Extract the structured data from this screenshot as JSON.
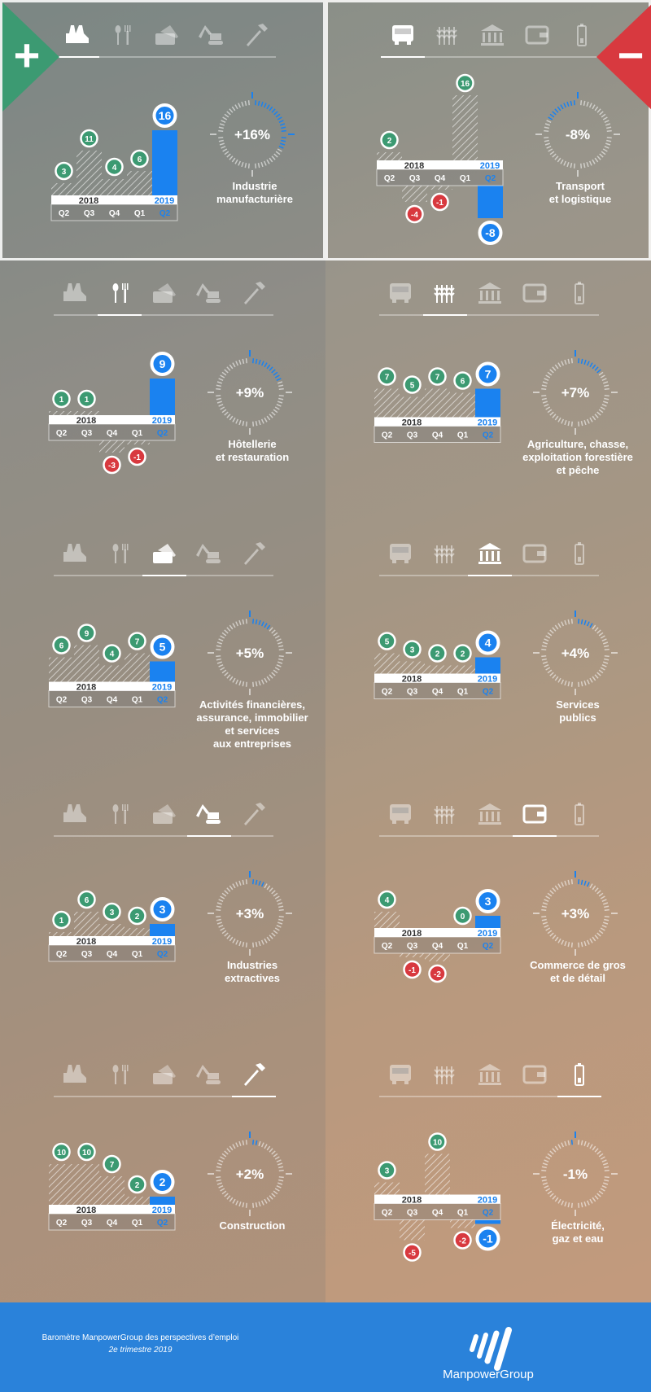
{
  "colors": {
    "positive": "#3c9a72",
    "negative": "#d8393f",
    "accent": "#1a82f0"
  },
  "axis": {
    "year_2018": "2018",
    "year_2019": "2019",
    "quarters": [
      "Q2",
      "Q3",
      "Q4",
      "Q1",
      "Q2"
    ]
  },
  "icon_sets": {
    "left": [
      "factory-icon",
      "fork-knife-icon",
      "credit-card-icon",
      "excavator-icon",
      "hammer-icon"
    ],
    "right": [
      "truck-icon",
      "wheat-icon",
      "bank-icon",
      "wallet-icon",
      "battery-icon"
    ]
  },
  "badges": {
    "plus": "+",
    "minus": "−"
  },
  "panels": [
    {
      "sector": "Industrie\nmanufacturière",
      "outlook": "+16%",
      "value": 16,
      "values": [
        3,
        11,
        4,
        6,
        16
      ],
      "icon_set": "left",
      "active_icon": 0,
      "badge": "plus"
    },
    {
      "sector": "Transport\net logistique",
      "outlook": "-8%",
      "value": -8,
      "values": [
        2,
        -4,
        -1,
        16,
        -8
      ],
      "icon_set": "right",
      "active_icon": 0,
      "badge": "minus"
    },
    {
      "sector": "Hôtellerie\net restauration",
      "outlook": "+9%",
      "value": 9,
      "values": [
        1,
        1,
        -3,
        -1,
        9
      ],
      "icon_set": "left",
      "active_icon": 1
    },
    {
      "sector": "Agriculture, chasse,\nexploitation forestière\net pêche",
      "outlook": "+7%",
      "value": 7,
      "values": [
        7,
        5,
        7,
        6,
        7
      ],
      "icon_set": "right",
      "active_icon": 1
    },
    {
      "sector": "Activités financières,\nassurance, immobilier\net services\naux entreprises",
      "outlook": "+5%",
      "value": 5,
      "values": [
        6,
        9,
        4,
        7,
        5
      ],
      "icon_set": "left",
      "active_icon": 2
    },
    {
      "sector": "Services\npublics",
      "outlook": "+4%",
      "value": 4,
      "values": [
        5,
        3,
        2,
        2,
        4
      ],
      "icon_set": "right",
      "active_icon": 2
    },
    {
      "sector": "Industries\nextractives",
      "outlook": "+3%",
      "value": 3,
      "values": [
        1,
        6,
        3,
        2,
        3
      ],
      "icon_set": "left",
      "active_icon": 3
    },
    {
      "sector": "Commerce de gros\net de détail",
      "outlook": "+3%",
      "value": 3,
      "values": [
        4,
        -1,
        -2,
        0,
        3
      ],
      "icon_set": "right",
      "active_icon": 3
    },
    {
      "sector": "Construction",
      "outlook": "+2%",
      "value": 2,
      "values": [
        10,
        10,
        7,
        2,
        2
      ],
      "icon_set": "left",
      "active_icon": 4
    },
    {
      "sector": "Électricité,\ngaz et eau",
      "outlook": "-1%",
      "value": -1,
      "values": [
        3,
        -5,
        10,
        -2,
        -1
      ],
      "icon_set": "right",
      "active_icon": 4
    }
  ],
  "footer": {
    "title": "Baromètre ManpowerGroup des perspectives d’emploi",
    "subtitle": "2e trimestre 2019",
    "logo_text": "ManpowerGroup"
  }
}
